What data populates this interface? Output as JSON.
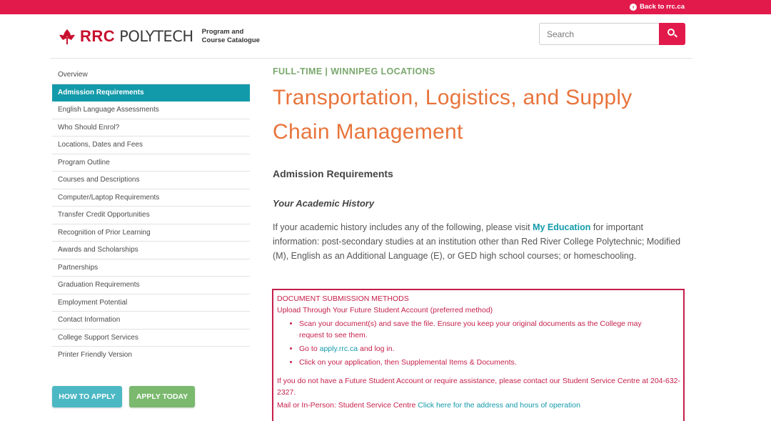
{
  "topbar": {
    "back_label": "Back to rrc.ca"
  },
  "header": {
    "logo_rrc": "RRC",
    "logo_polytech": "POLYTECH",
    "logo_sub_line1": "Program and",
    "logo_sub_line2": "Course Catalogue",
    "search_placeholder": "Search"
  },
  "sidebar": {
    "items": [
      {
        "label": "Overview",
        "active": false
      },
      {
        "label": "Admission Requirements",
        "active": true
      },
      {
        "label": "English Language Assessments",
        "active": false
      },
      {
        "label": "Who Should Enrol?",
        "active": false
      },
      {
        "label": "Locations, Dates and Fees",
        "active": false
      },
      {
        "label": "Program Outline",
        "active": false
      },
      {
        "label": "Courses and Descriptions",
        "active": false
      },
      {
        "label": "Computer/Laptop Requirements",
        "active": false
      },
      {
        "label": "Transfer Credit Opportunities",
        "active": false
      },
      {
        "label": "Recognition of Prior Learning",
        "active": false
      },
      {
        "label": "Awards and Scholarships",
        "active": false
      },
      {
        "label": "Partnerships",
        "active": false
      },
      {
        "label": "Graduation Requirements",
        "active": false
      },
      {
        "label": "Employment Potential",
        "active": false
      },
      {
        "label": "Contact Information",
        "active": false
      },
      {
        "label": "College Support Services",
        "active": false
      },
      {
        "label": "Printer Friendly Version",
        "active": false
      }
    ],
    "how_to_apply": "HOW TO APPLY",
    "apply_today": "APPLY TODAY"
  },
  "main": {
    "eyebrow": "FULL-TIME | WINNIPEG LOCATIONS",
    "title_line1": "Transportation, Logistics, and Supply",
    "title_line2": "Chain Management",
    "section_heading": "Admission Requirements",
    "subheading": "Your Academic History",
    "para_before_link": "If your academic history includes any of the following, please visit ",
    "para_link": "My Education",
    "para_after_link": " for important information: post-secondary studies at an institution other than Red River College Polytechnic; Modified (M), English as an Additional Language (E), or GED high school courses; or homeschooling."
  },
  "doc_box": {
    "title": "DOCUMENT SUBMISSION METHODS",
    "subtitle": "Upload Through Your Future Student Account (preferred method)",
    "bullet1": "Scan your document(s) and save the file. Ensure you keep your original documents as the College may request to see them.",
    "bullet2_before": "Go to ",
    "bullet2_link": "apply.rrc.ca",
    "bullet2_after": " and log in.",
    "bullet3": "Click on your application, then Supplemental Items & Documents.",
    "para": "If you do not have a Future Student Account or require assistance, please contact our Student Service Centre at 204-632-2327.",
    "mail_label": "Mail or In-Person:",
    "mail_text": " Student Service Centre ",
    "mail_link": "Click here for the address and hours of operation"
  },
  "colors": {
    "topbar": "#e21a4c",
    "active_nav": "#139aaa",
    "title": "#e8743b",
    "eyebrow": "#7aa86d",
    "link": "#139aaa",
    "doc_border": "#c51f4a",
    "how_to_apply_btn": "#4cb8c4",
    "apply_today_btn": "#7ab96e"
  },
  "icons": {
    "back": "arrow-left-circle-icon",
    "search": "search-icon",
    "logo": "rrc-leaf-logo"
  }
}
